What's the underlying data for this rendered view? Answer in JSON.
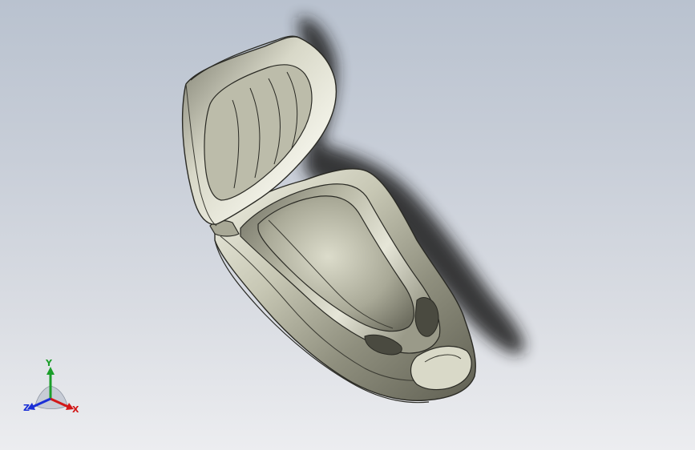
{
  "viewport": {
    "background_top": "#b9c2cf",
    "background_bottom": "#ecedf0",
    "model_color": "#c9c9b6",
    "edge_color": "#2a2a24"
  },
  "triad": {
    "y_label": "Y",
    "x_label": "X",
    "z_label": "Z",
    "y_color": "#1b9e2a",
    "x_color": "#d21818",
    "z_color": "#1a2fd6"
  }
}
